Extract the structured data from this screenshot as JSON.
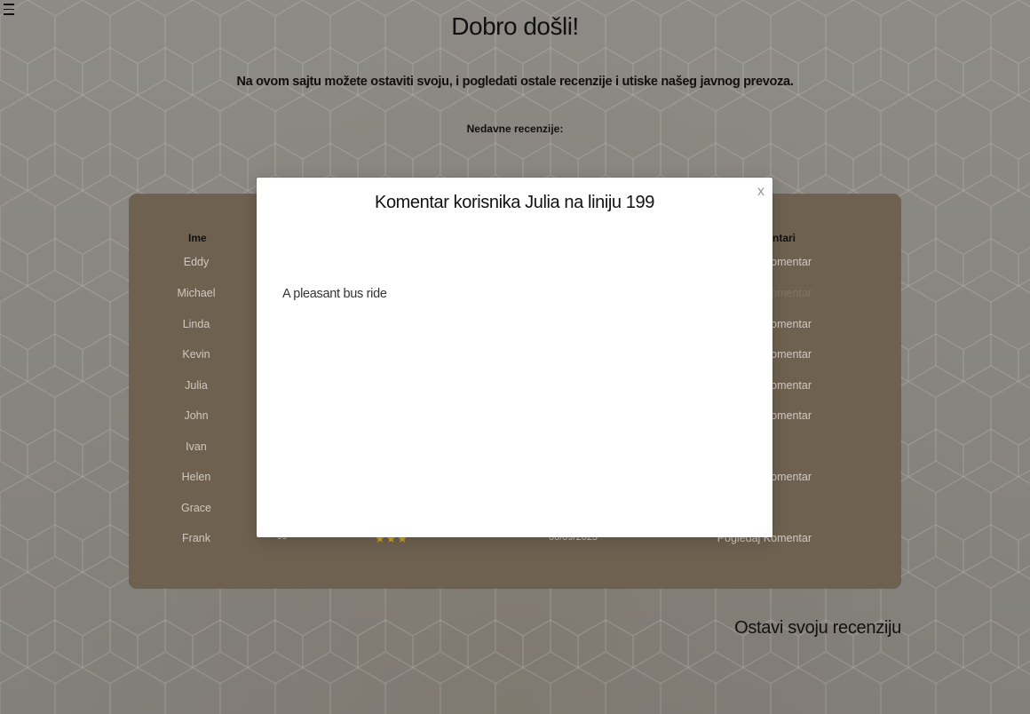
{
  "header": {
    "title": "Dobro došli!",
    "subtitle": "Na ovom sajtu možete ostaviti svoju, i pogledati ostale recenzije i utiske našeg javnog prevoza.",
    "recent_label": "Nedavne recenzije:"
  },
  "menu": {
    "icon": "hamburger-menu-icon"
  },
  "table": {
    "headers": {
      "name": "Ime",
      "comments": "entari"
    },
    "rows": [
      {
        "name": "Eddy",
        "line": "",
        "stars": "",
        "date": "",
        "comment": "Komentar",
        "faded": false
      },
      {
        "name": "Michael",
        "line": "",
        "stars": "",
        "date": "",
        "comment": "omentar",
        "faded": true
      },
      {
        "name": "Linda",
        "line": "",
        "stars": "",
        "date": "",
        "comment": "Komentar",
        "faded": false
      },
      {
        "name": "Kevin",
        "line": "",
        "stars": "",
        "date": "",
        "comment": "Komentar",
        "faded": false
      },
      {
        "name": "Julia",
        "line": "",
        "stars": "",
        "date": "",
        "comment": "Komentar",
        "faded": false
      },
      {
        "name": "John",
        "line": "",
        "stars": "",
        "date": "",
        "comment": "Komentar",
        "faded": false
      },
      {
        "name": "Ivan",
        "line": "",
        "stars": "",
        "date": "",
        "comment": "",
        "faded": true
      },
      {
        "name": "Helen",
        "line": "",
        "stars": "",
        "date": "",
        "comment": "Komentar",
        "faded": false
      },
      {
        "name": "Grace",
        "line": "",
        "stars": "",
        "date": "",
        "comment": "",
        "faded": true
      },
      {
        "name": "Frank",
        "line": "99",
        "stars": "★★★",
        "date": "00/09/2023",
        "comment": "Pogledaj Komentar",
        "faded": false
      }
    ]
  },
  "leave_review": "Ostavi svoju recenziju",
  "modal": {
    "title": "Komentar korisnika Julia na liniju 199",
    "close": "x",
    "body": "A pleasant bus ride"
  },
  "colors": {
    "background": "#8a8782",
    "panel": "#6e6150",
    "star": "#c9a32a",
    "modal": "#ffffff"
  }
}
